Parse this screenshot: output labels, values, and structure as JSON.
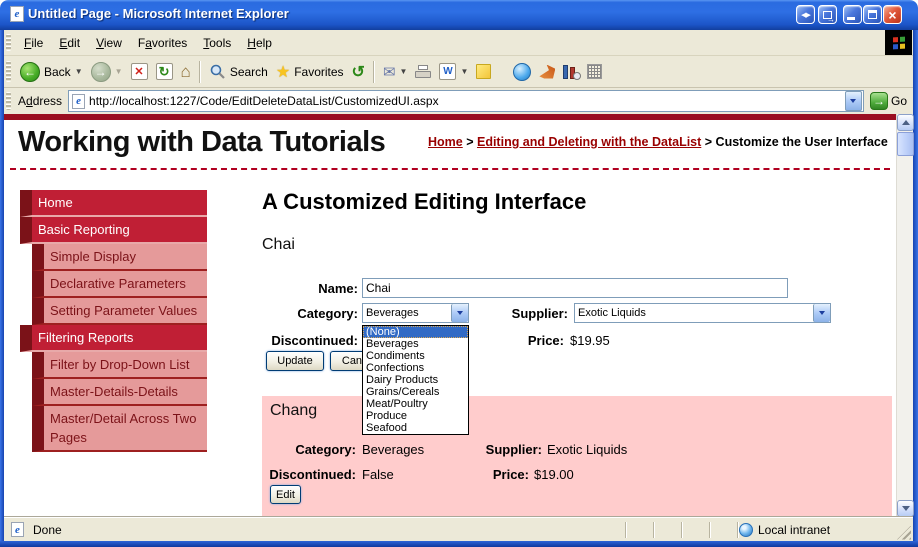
{
  "window": {
    "title": "Untitled Page - Microsoft Internet Explorer"
  },
  "menu_bar": {
    "items": [
      {
        "label": "File",
        "accel": 0
      },
      {
        "label": "Edit",
        "accel": 0
      },
      {
        "label": "View",
        "accel": 0
      },
      {
        "label": "Favorites",
        "accel": 1
      },
      {
        "label": "Tools",
        "accel": 0
      },
      {
        "label": "Help",
        "accel": 0
      }
    ]
  },
  "toolbar": {
    "back_label": "Back",
    "search_label": "Search",
    "favorites_label": "Favorites"
  },
  "address_bar": {
    "label": "Address",
    "accel": 1,
    "url": "http://localhost:1227/Code/EditDeleteDataList/CustomizedUI.aspx",
    "go_label": "Go"
  },
  "icons": {
    "back_arrow": "←",
    "forward_arrow": "→",
    "stop": "✕",
    "refresh": "↻",
    "home": "⌂",
    "favorites_star": "★",
    "history": "↺",
    "mail": "✉",
    "word": "W",
    "close": "×",
    "go_arrow": "→",
    "ie_e": "e",
    "nav_arrows": "◀▶"
  },
  "page": {
    "site_title": "Working with Data Tutorials",
    "breadcrumb": {
      "links": [
        "Home",
        "Editing and Deleting with the DataList"
      ],
      "separator": " > ",
      "current": "Customize the User Interface"
    },
    "sidebar": {
      "items": [
        {
          "label": "Home",
          "level": 1
        },
        {
          "label": "Basic Reporting",
          "level": 1
        },
        {
          "label": "Simple Display",
          "level": 2
        },
        {
          "label": "Declarative Parameters",
          "level": 2
        },
        {
          "label": "Setting Parameter Values",
          "level": 2
        },
        {
          "label": "Filtering Reports",
          "level": 1
        },
        {
          "label": "Filter by Drop-Down List",
          "level": 2
        },
        {
          "label": "Master-Details-Details",
          "level": 2
        },
        {
          "label": "Master/Detail Across Two Pages",
          "level": 2
        }
      ]
    },
    "main": {
      "heading": "A Customized Editing Interface",
      "edit_item": {
        "title": "Chai",
        "name_label": "Name:",
        "name_value": "Chai",
        "category_label": "Category:",
        "category_value": "Beverages",
        "supplier_label": "Supplier:",
        "supplier_value": "Exotic Liquids",
        "discontinued_label": "Discontinued:",
        "price_label": "Price:",
        "price_value": "$19.95",
        "update_label": "Update",
        "cancel_label": "Cancel"
      },
      "category_dropdown": {
        "selected": "(None)",
        "options": [
          "(None)",
          "Beverages",
          "Condiments",
          "Confections",
          "Dairy Products",
          "Grains/Cereals",
          "Meat/Poultry",
          "Produce",
          "Seafood"
        ]
      },
      "view_item": {
        "title": "Chang",
        "category_label": "Category:",
        "category_value": "Beverages",
        "supplier_label": "Supplier:",
        "supplier_value": "Exotic Liquids",
        "discontinued_label": "Discontinued:",
        "discontinued_value": "False",
        "price_label": "Price:",
        "price_value": "$19.00",
        "edit_label": "Edit"
      }
    }
  },
  "status_bar": {
    "status": "Done",
    "zone": "Local intranet"
  },
  "colors": {
    "titlebar_blue": "#2E6FE4",
    "chrome_beige": "#ECE9D8",
    "top_rule_maroon": "#9A0E20",
    "link_maroon": "#990000",
    "nav_crimson": "#C01F35",
    "nav_dark_maroon": "#7B1218",
    "nav_pink": "#E59A9A",
    "item_panel_pink": "#FFCCCC",
    "selection_blue": "#316AC5",
    "control_border": "#7F9DB9"
  }
}
